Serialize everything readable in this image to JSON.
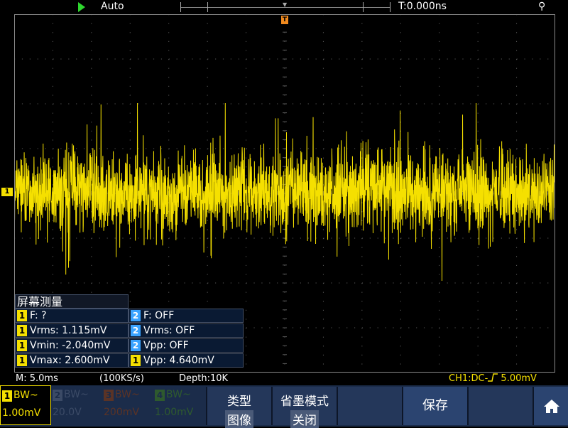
{
  "top": {
    "trigger_mode": "Auto",
    "trigger_time": "T:0.000ns",
    "trig_pos_label": "T",
    "ch1_marker": "1"
  },
  "measure": {
    "title": "屏幕测量",
    "rows": [
      {
        "ch_left": "1",
        "left": "F:   ?",
        "ch_right": "2",
        "right": "F: OFF"
      },
      {
        "ch_left": "1",
        "left": "Vrms: 1.115mV",
        "ch_right": "2",
        "right": "Vrms: OFF"
      },
      {
        "ch_left": "1",
        "left": "Vmin: -2.040mV",
        "ch_right": "2",
        "right": "Vpp: OFF"
      },
      {
        "ch_left": "1",
        "left": "Vmax: 2.600mV",
        "ch_right": "1",
        "right": "Vpp: 4.640mV"
      }
    ]
  },
  "status": {
    "timebase": "M: 5.0ms",
    "sample_rate": "(100KS/s)",
    "depth": "Depth:10K",
    "ch1_coupling": "CH1:DC-═╱  5.00mV"
  },
  "channels": [
    {
      "num": "1",
      "bw": "BW~",
      "volt": "1.00mV",
      "color": "#f5e000"
    },
    {
      "num": "2",
      "bw": "BW~",
      "volt": "20.0V",
      "color": "#3aa3ff"
    },
    {
      "num": "3",
      "bw": "BW~",
      "volt": "200mV",
      "color": "#f05a28"
    },
    {
      "num": "4",
      "bw": "BW~",
      "volt": "1.00mV",
      "color": "#2ecc40"
    }
  ],
  "menu": {
    "type_label": "类型",
    "type_value": "图像",
    "inksave_label": "省墨模式",
    "inksave_value": "关闭",
    "save_label": "保存"
  },
  "colors": {
    "trace": "#f5e000",
    "grid": "#5a5a5a",
    "menu_bg": "#1b2c4a"
  },
  "icons": {
    "run": "play-triangle-icon",
    "usb": "usb-icon",
    "home": "home-icon"
  }
}
